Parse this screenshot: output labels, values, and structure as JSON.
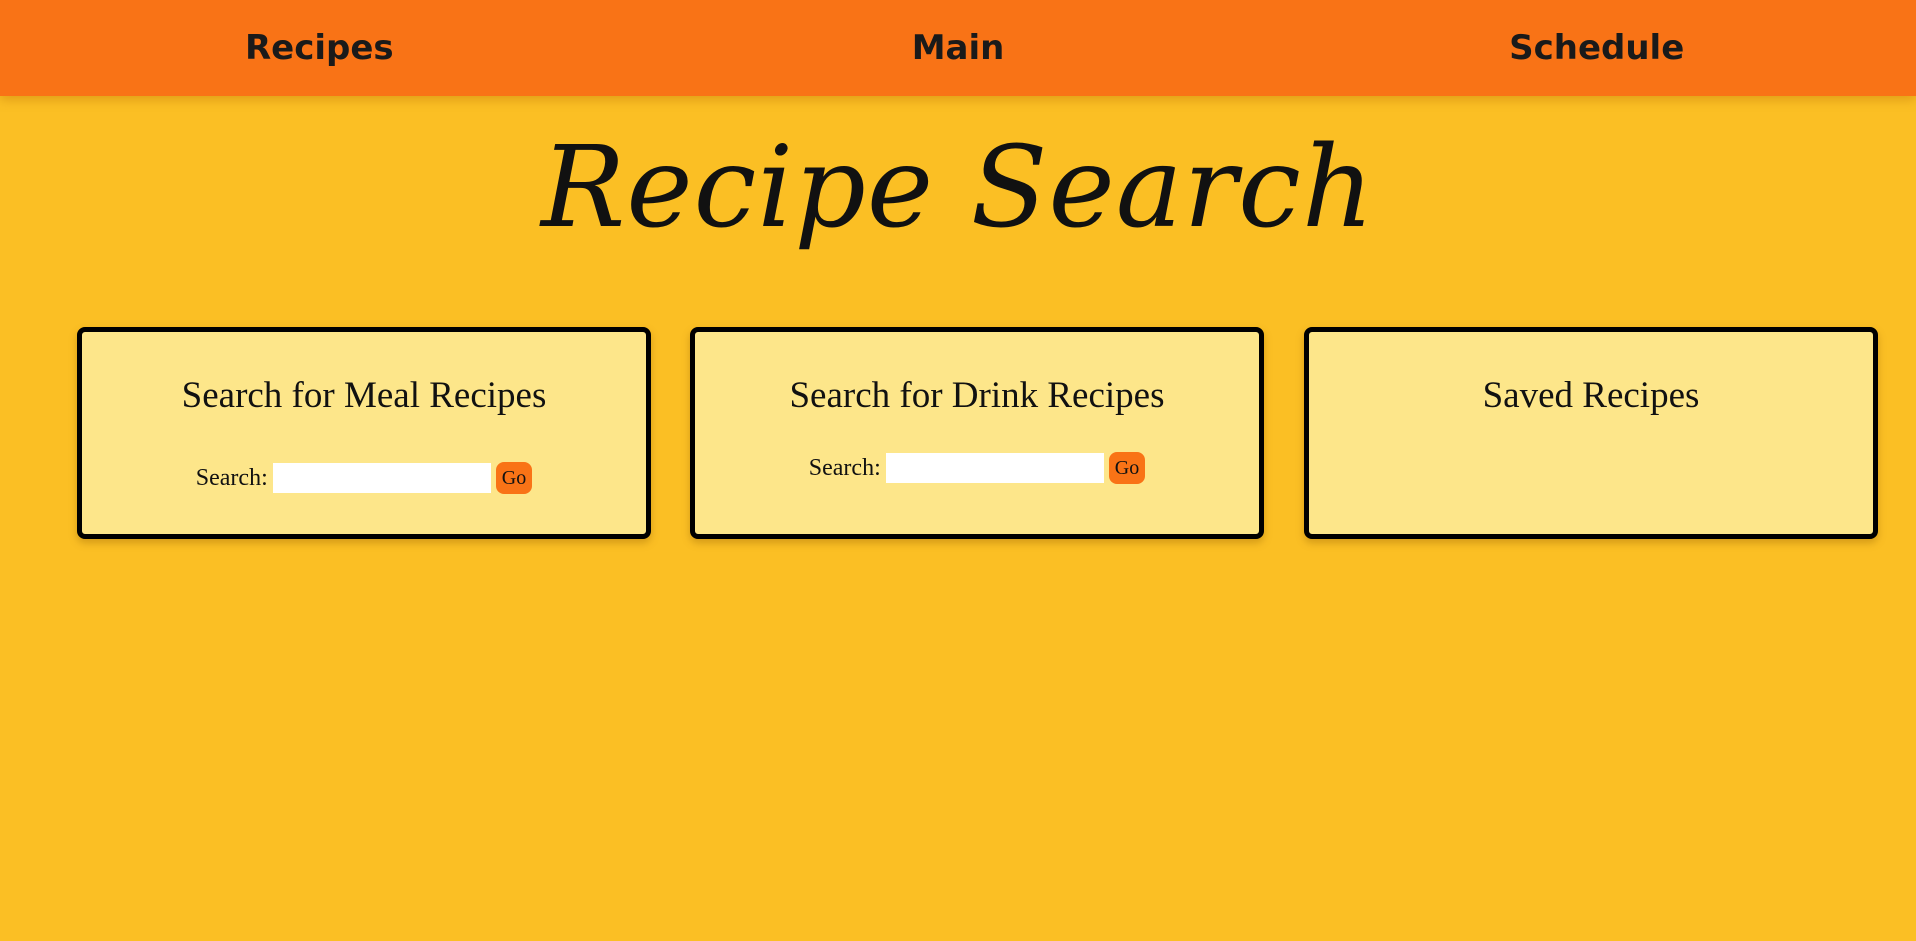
{
  "nav": {
    "items": [
      {
        "label": "Recipes"
      },
      {
        "label": "Main"
      },
      {
        "label": "Schedule"
      }
    ]
  },
  "page": {
    "title": "Recipe Search"
  },
  "cards": {
    "meal": {
      "title": "Search for Meal Recipes",
      "search_label": "Search:",
      "input_value": "",
      "button_label": "Go"
    },
    "drink": {
      "title": "Search for Drink Recipes",
      "search_label": "Search:",
      "input_value": "",
      "button_label": "Go"
    },
    "saved": {
      "title": "Saved Recipes"
    }
  },
  "colors": {
    "background": "#FBBF24",
    "nav_bar": "#F97316",
    "card_background": "#FDE68A",
    "card_border": "#000000",
    "button": "#F97316"
  }
}
